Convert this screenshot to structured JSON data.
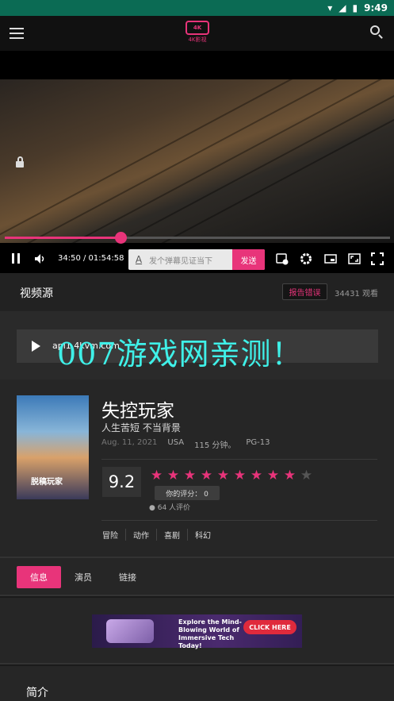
{
  "status_bar": {
    "time": "9:49"
  },
  "app": {
    "logo_text": "4K影视",
    "logo_badge": "4K"
  },
  "player": {
    "time_text": "34:50 / 01:54:58",
    "progress": 0.301,
    "danmaku_placeholder": "发个弹幕见证当下",
    "send_label": "发送"
  },
  "source": {
    "title": "视频源",
    "report_label": "报告错误",
    "views": "34431 观看",
    "source_url": "api1.4kvm.com"
  },
  "watermark": "007游戏网亲测！",
  "movie": {
    "title": "失控玩家",
    "tagline": "人生苦短 不当背景",
    "date": "Aug. 11, 2021",
    "country": "USA",
    "runtime": "115 分钟。",
    "rating_code": "PG-13",
    "score": "9.2",
    "stars_filled": 9,
    "stars_total": 10,
    "my_rating": "你的评分： 0",
    "raters": "64 人评价",
    "genres": [
      "冒险",
      "动作",
      "喜剧",
      "科幻"
    ],
    "poster_title": "脱稿玩家"
  },
  "tabs": [
    {
      "label": "信息",
      "active": true
    },
    {
      "label": "演员",
      "active": false
    },
    {
      "label": "链接",
      "active": false
    }
  ],
  "ad": {
    "text": "Explore the Mind-Blowing World of Immersive Tech Today!",
    "button": "CLICK HERE"
  },
  "intro": {
    "title": "简介"
  },
  "colors": {
    "accent": "#e8347a",
    "status_bar": "#0b6b54",
    "watermark": "#3ff0e8"
  }
}
